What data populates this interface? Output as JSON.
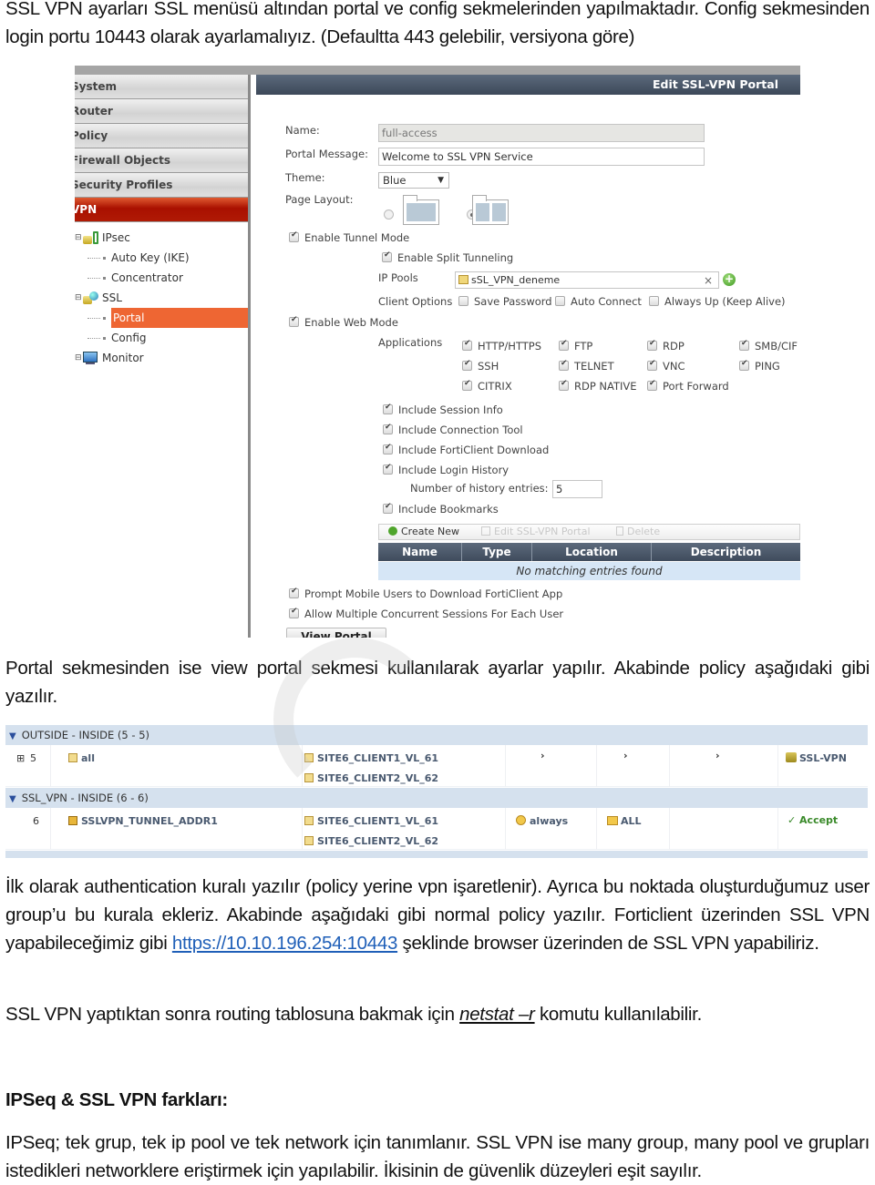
{
  "paragraphs": {
    "p1": "SSL VPN ayarları SSL menüsü altından portal ve config sekmelerinden yapılmaktadır. Config sekmesinden login portu 10443 olarak ayarlamalıyız. (Defaultta 443 gelebilir, versiyona göre)",
    "p2": "Portal sekmesinden ise view portal sekmesi kullanılarak ayarlar yapılır. Akabinde policy aşağıdaki gibi yazılır.",
    "p3_before_link": "İlk olarak authentication kuralı yazılır (policy yerine vpn işaretlenir). Ayrıca bu noktada oluşturduğumuz user group’u bu kurala ekleriz. Akabinde aşağıdaki gibi normal policy yazılır. Forticlient üzerinden SSL VPN yapabileceğimiz gibi ",
    "p3_link": "https://10.10.196.254:10443",
    "p3_after_link": " şeklinde browser üzerinden de SSL VPN yapabiliriz.",
    "p4_before_cmd": "SSL VPN yaptıktan sonra routing tablosuna bakmak için ",
    "p4_cmd": "netstat –r",
    "p4_after_cmd": " komutu kullanılabilir.",
    "heading": "IPSeq & SSL VPN farkları:",
    "p5": "IPSeq; tek grup, tek ip pool ve tek network için tanımlanır. SSL VPN ise many group, many pool ve grupları istedikleri networklere eriştirmek için yapılabilir. İkisinin de güvenlik düzeyleri eşit sayılır."
  },
  "portal_screenshot": {
    "sidebar": {
      "menu": [
        "System",
        "Router",
        "Policy",
        "Firewall Objects",
        "Security Profiles",
        "VPN"
      ],
      "active_menu": "VPN",
      "tree": [
        {
          "label": "IPsec",
          "level": 1
        },
        {
          "label": "Auto Key (IKE)",
          "level": 2
        },
        {
          "label": "Concentrator",
          "level": 2
        },
        {
          "label": "SSL",
          "level": 1
        },
        {
          "label": "Portal",
          "level": 2,
          "selected": true
        },
        {
          "label": "Config",
          "level": 2
        },
        {
          "label": "Monitor",
          "level": 1
        }
      ]
    },
    "header_title": "Edit SSL-VPN Portal",
    "form": {
      "name_label": "Name:",
      "name_value": "full-access",
      "portal_message_label": "Portal Message:",
      "portal_message_value": "Welcome to SSL VPN Service",
      "theme_label": "Theme:",
      "theme_value": "Blue",
      "page_layout_label": "Page Layout:",
      "page_layout_selected": "two-column",
      "enable_tunnel_mode": "Enable Tunnel Mode",
      "enable_split_tunneling": "Enable Split Tunneling",
      "ip_pools_label": "IP Pools",
      "ip_pools_value": "sSL_VPN_deneme",
      "client_options_label": "Client Options",
      "client_options": [
        "Save Password",
        "Auto Connect",
        "Always Up (Keep Alive)"
      ],
      "enable_web_mode": "Enable Web Mode",
      "applications_label": "Applications",
      "applications": [
        "HTTP/HTTPS",
        "FTP",
        "RDP",
        "SMB/CIF",
        "SSH",
        "TELNET",
        "VNC",
        "PING",
        "CITRIX",
        "RDP NATIVE",
        "Port Forward"
      ],
      "include_session_info": "Include Session Info",
      "include_connection_tool": "Include Connection Tool",
      "include_forticlient_download": "Include FortiClient Download",
      "include_login_history": "Include Login History",
      "history_entries_label": "Number of history entries:",
      "history_entries_value": "5",
      "include_bookmarks": "Include Bookmarks",
      "toolbar": {
        "create_new": "Create New",
        "edit": "Edit SSL-VPN Portal",
        "delete": "Delete"
      },
      "columns": [
        "Name",
        "Type",
        "Location",
        "Description"
      ],
      "empty_message": "No matching entries found",
      "prompt_mobile": "Prompt Mobile Users to Download FortiClient App",
      "allow_concurrent": "Allow Multiple Concurrent Sessions For Each User",
      "view_portal": "View Portal"
    }
  },
  "policy_screenshot": {
    "groups": [
      {
        "title": "OUTSIDE - INSIDE (5 - 5)",
        "row": {
          "id": "5",
          "source": "all",
          "destinations": [
            "SITE6_CLIENT1_VL_61",
            "SITE6_CLIENT2_VL_62"
          ],
          "schedule": "›",
          "service": "›",
          "col6": "›",
          "action": "SSL-VPN"
        }
      },
      {
        "title": "SSL_VPN - INSIDE (6 - 6)",
        "row": {
          "id": "6",
          "source": "SSLVPN_TUNNEL_ADDR1",
          "destinations": [
            "SITE6_CLIENT1_VL_61",
            "SITE6_CLIENT2_VL_62"
          ],
          "schedule": "always",
          "service": "ALL",
          "col6": "",
          "action": "✓ Accept"
        }
      }
    ]
  }
}
